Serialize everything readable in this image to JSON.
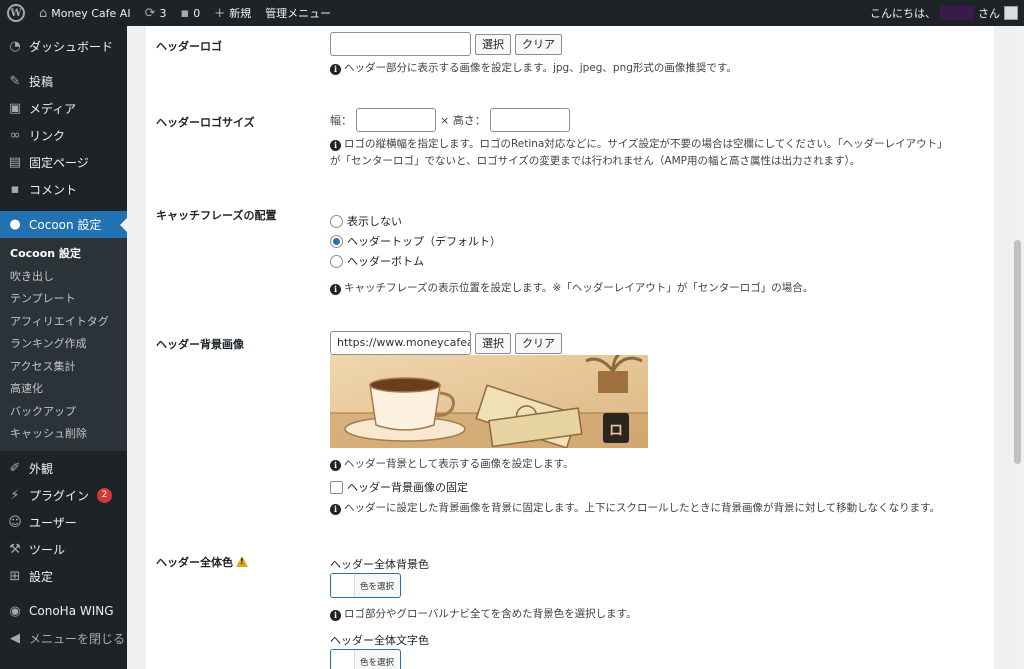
{
  "adminbar": {
    "site_name": "Money Cafe AI",
    "updates_count": "3",
    "comments_count": "0",
    "new_label": "新規",
    "admin_menu_label": "管理メニュー",
    "greeting_prefix": "こんにちは、",
    "greeting_suffix": "さん"
  },
  "sidebar": {
    "top_items": [
      {
        "label": "ダッシュボード",
        "icon": "dashboard-icon"
      },
      {
        "label": "投稿",
        "icon": "pin-icon"
      },
      {
        "label": "メディア",
        "icon": "media-icon"
      },
      {
        "label": "リンク",
        "icon": "link-icon"
      },
      {
        "label": "固定ページ",
        "icon": "page-icon"
      },
      {
        "label": "コメント",
        "icon": "comment-icon"
      }
    ],
    "current_item": {
      "label": "Cocoon 設定",
      "icon": "cocoon-icon"
    },
    "submenu": [
      "Cocoon 設定",
      "吹き出し",
      "テンプレート",
      "アフィリエイトタグ",
      "ランキング作成",
      "アクセス集計",
      "高速化",
      "バックアップ",
      "キャッシュ削除"
    ],
    "bottom_items": [
      {
        "label": "外観",
        "icon": "appearance-icon"
      },
      {
        "label": "プラグイン",
        "icon": "plugin-icon",
        "badge": "2"
      },
      {
        "label": "ユーザー",
        "icon": "user-icon"
      },
      {
        "label": "ツール",
        "icon": "tool-icon"
      },
      {
        "label": "設定",
        "icon": "settings-icon"
      }
    ],
    "conoha_label": "ConoHa WING",
    "close_menu_label": "メニューを閉じる"
  },
  "settings": {
    "header_logo": {
      "label": "ヘッダーロゴ",
      "value": "",
      "select_button": "選択",
      "clear_button": "クリア",
      "description": "ヘッダー部分に表示する画像を設定します。jpg、jpeg、png形式の画像推奨です。"
    },
    "header_logo_size": {
      "label": "ヘッダーロゴサイズ",
      "width_label": "幅：",
      "height_label": "× 高さ：",
      "width_value": "",
      "height_value": "",
      "description_line1": "ロゴの縦横幅を指定します。ロゴのRetina対応などに。サイズ設定が不要の場合は空欄にしてください。「ヘッダーレイアウト」",
      "description_line2": "が「センターロゴ」でないと、ロゴサイズの変更までは行われません（AMP用の幅と高さ属性は出力されます）。"
    },
    "catchphrase_position": {
      "label": "キャッチフレーズの配置",
      "options": [
        "表示しない",
        "ヘッダートップ（デフォルト）",
        "ヘッダーボトム"
      ],
      "selected": "ヘッダートップ（デフォルト）",
      "description": "キャッチフレーズの表示位置を設定します。※「ヘッダーレイアウト」が「センターロゴ」の場合。"
    },
    "header_bg_image": {
      "label": "ヘッダー背景画像",
      "value": "https://www.moneycafeai.",
      "select_button": "選択",
      "clear_button": "クリア",
      "description": "ヘッダー背景として表示する画像を設定します。",
      "fixed_label": "ヘッダー背景画像の固定",
      "fixed_checked": false,
      "fixed_description": "ヘッダーに設定した背景画像を背景に固定します。上下にスクロールしたときに背景画像が背景に対して移動しなくなります。"
    },
    "header_color": {
      "label": "ヘッダー全体色",
      "bg_color_label": "ヘッダー全体背景色",
      "bg_color_button": "色を選択",
      "bg_color_description": "ロゴ部分やグローバルナビ全てを含めた背景色を選択します。",
      "text_color_label": "ヘッダー全体文字色",
      "text_color_button": "色を選択"
    }
  },
  "colors": {
    "adminbar_bg": "#1d2327",
    "accent": "#2271b1",
    "badge": "#d63638"
  }
}
